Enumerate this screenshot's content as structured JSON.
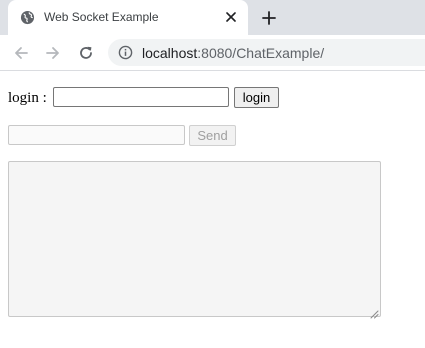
{
  "browser": {
    "tab": {
      "title": "Web Socket Example",
      "favicon": "globe-icon"
    },
    "url": {
      "host": "localhost",
      "rest": ":8080/ChatExample/"
    },
    "icons": {
      "back": "arrow-left-icon",
      "forward": "arrow-right-icon",
      "reload": "reload-icon",
      "info": "info-icon",
      "close": "close-icon",
      "new_tab": "plus-icon"
    }
  },
  "page": {
    "login": {
      "label": "login :",
      "input_value": "",
      "button_label": "login"
    },
    "message": {
      "input_value": "",
      "send_label": "Send"
    },
    "chat_log": ""
  }
}
